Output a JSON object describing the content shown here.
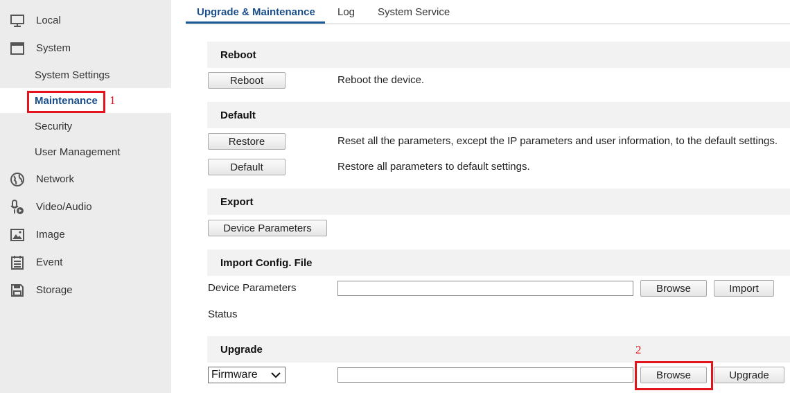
{
  "sidebar": {
    "items": [
      {
        "label": "Local",
        "icon": "monitor-icon"
      },
      {
        "label": "System",
        "icon": "window-icon"
      },
      {
        "label": "Network",
        "icon": "globe-icon"
      },
      {
        "label": "Video/Audio",
        "icon": "microphone-camera-icon"
      },
      {
        "label": "Image",
        "icon": "image-icon"
      },
      {
        "label": "Event",
        "icon": "calendar-icon"
      },
      {
        "label": "Storage",
        "icon": "floppy-disk-icon"
      }
    ],
    "system_subitems": [
      {
        "label": "System Settings"
      },
      {
        "label": "Maintenance"
      },
      {
        "label": "Security"
      },
      {
        "label": "User Management"
      }
    ],
    "annotation_1": "1"
  },
  "tabs": [
    {
      "label": "Upgrade & Maintenance"
    },
    {
      "label": "Log"
    },
    {
      "label": "System Service"
    }
  ],
  "reboot": {
    "title": "Reboot",
    "button": "Reboot",
    "description": "Reboot the device."
  },
  "default": {
    "title": "Default",
    "restore_button": "Restore",
    "restore_description": "Reset all the parameters, except the IP parameters and user information, to the default settings.",
    "default_button": "Default",
    "default_description": "Restore all parameters to default settings."
  },
  "export": {
    "title": "Export",
    "button": "Device Parameters"
  },
  "import": {
    "title": "Import Config. File",
    "field_label": "Device Parameters",
    "file_value": "",
    "browse_button": "Browse",
    "import_button": "Import",
    "status_label": "Status"
  },
  "upgrade": {
    "title": "Upgrade",
    "type_selected": "Firmware",
    "file_value": "",
    "browse_button": "Browse",
    "upgrade_button": "Upgrade",
    "annotation_2": "2"
  },
  "colors": {
    "accent": "#1a4f8b",
    "annotation": "#e3141b",
    "sidebar_bg": "#ececec",
    "section_bg": "#f2f2f2"
  }
}
